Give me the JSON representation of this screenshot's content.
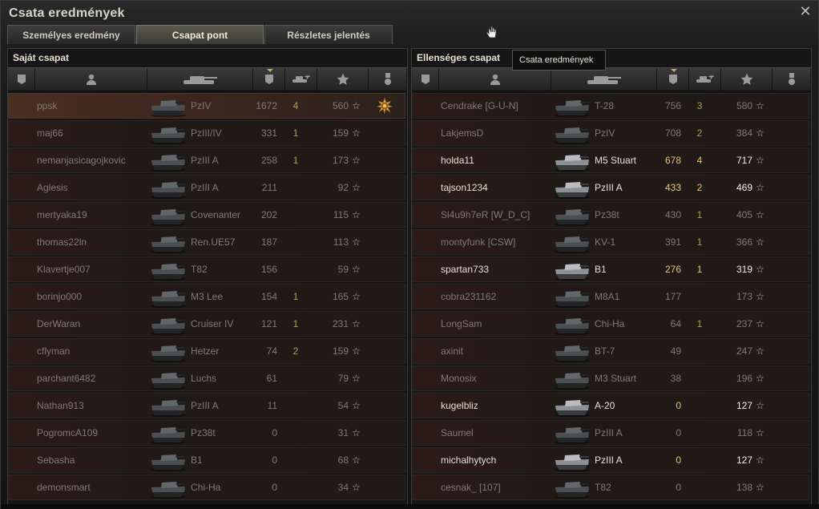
{
  "window": {
    "title": "Csata eredmények"
  },
  "tabs": [
    {
      "label": "Személyes eredmény",
      "active": false
    },
    {
      "label": "Csapat pont",
      "active": true
    },
    {
      "label": "Részletes jelentés",
      "active": false
    }
  ],
  "tooltip": {
    "text": "Csata eredmények"
  },
  "columns": [
    "platoon-icon",
    "player-icon",
    "tank-icon",
    "damage-icon",
    "kills-icon",
    "xp-star-icon",
    "medal-icon"
  ],
  "own_team": {
    "title": "Saját csapat",
    "rows": [
      {
        "name": "ppsk",
        "tank": "PzIV",
        "damage": "1672",
        "kills": "4",
        "xp": "560",
        "medal": true,
        "player": true,
        "alive": false
      },
      {
        "name": "maj66",
        "tank": "PzIII/IV",
        "damage": "331",
        "kills": "1",
        "xp": "159",
        "alive": false
      },
      {
        "name": "nemanjasicagojkovic",
        "tank": "PzIII A",
        "damage": "258",
        "kills": "1",
        "xp": "173",
        "alive": false
      },
      {
        "name": "Aglesis",
        "tank": "PzIII A",
        "damage": "211",
        "kills": "",
        "xp": "92",
        "alive": false
      },
      {
        "name": "mertyaka19",
        "tank": "Covenanter",
        "damage": "202",
        "kills": "",
        "xp": "115",
        "alive": false
      },
      {
        "name": "thomas22ln",
        "tank": "Ren.UE57",
        "damage": "187",
        "kills": "",
        "xp": "113",
        "alive": false
      },
      {
        "name": "Klavertje007",
        "tank": "T82",
        "damage": "156",
        "kills": "",
        "xp": "59",
        "alive": false
      },
      {
        "name": "borinjo000",
        "tank": "M3 Lee",
        "damage": "154",
        "kills": "1",
        "xp": "165",
        "alive": false
      },
      {
        "name": "DerWaran",
        "tank": "Cruiser IV",
        "damage": "121",
        "kills": "1",
        "xp": "231",
        "alive": false
      },
      {
        "name": "cflyman",
        "tank": "Hetzer",
        "damage": "74",
        "kills": "2",
        "xp": "159",
        "alive": false
      },
      {
        "name": "parchant6482",
        "tank": "Luchs",
        "damage": "61",
        "kills": "",
        "xp": "79",
        "alive": false
      },
      {
        "name": "Nathan913",
        "tank": "PzIII A",
        "damage": "11",
        "kills": "",
        "xp": "54",
        "alive": false
      },
      {
        "name": "PogromcA109",
        "tank": "Pz38t",
        "damage": "0",
        "kills": "",
        "xp": "31",
        "alive": false
      },
      {
        "name": "Sebasha",
        "tank": "B1",
        "damage": "0",
        "kills": "",
        "xp": "68",
        "alive": false
      },
      {
        "name": "demonsmart",
        "tank": "Chi-Ha",
        "damage": "0",
        "kills": "",
        "xp": "34",
        "alive": false
      }
    ]
  },
  "enemy_team": {
    "title": "Ellenséges csapat",
    "rows": [
      {
        "name": "Cendrake [G-U-N]",
        "tank": "T-28",
        "damage": "756",
        "kills": "3",
        "xp": "580",
        "alive": false
      },
      {
        "name": "LakjemsD",
        "tank": "PzIV",
        "damage": "708",
        "kills": "2",
        "xp": "384",
        "alive": false
      },
      {
        "name": "holda11",
        "tank": "M5 Stuart",
        "damage": "678",
        "kills": "4",
        "xp": "717",
        "alive": true
      },
      {
        "name": "tajson1234",
        "tank": "PzIII A",
        "damage": "433",
        "kills": "2",
        "xp": "469",
        "alive": true
      },
      {
        "name": "Sl4u9h7eR [W_D_C]",
        "tank": "Pz38t",
        "damage": "430",
        "kills": "1",
        "xp": "405",
        "alive": false
      },
      {
        "name": "montyfunk [CSW]",
        "tank": "KV-1",
        "damage": "391",
        "kills": "1",
        "xp": "366",
        "alive": false
      },
      {
        "name": "spartan733",
        "tank": "B1",
        "damage": "276",
        "kills": "1",
        "xp": "319",
        "alive": true
      },
      {
        "name": "cobra231162",
        "tank": "M8A1",
        "damage": "177",
        "kills": "",
        "xp": "173",
        "alive": false
      },
      {
        "name": "LongSam",
        "tank": "Chi-Ha",
        "damage": "64",
        "kills": "1",
        "xp": "237",
        "alive": false
      },
      {
        "name": "axinit",
        "tank": "BT-7",
        "damage": "49",
        "kills": "",
        "xp": "247",
        "alive": false
      },
      {
        "name": "Monosix",
        "tank": "M3 Stuart",
        "damage": "38",
        "kills": "",
        "xp": "196",
        "alive": false
      },
      {
        "name": "kugelbliz",
        "tank": "A-20",
        "damage": "0",
        "kills": "",
        "xp": "127",
        "alive": true
      },
      {
        "name": "Saumel",
        "tank": "PzIII A",
        "damage": "0",
        "kills": "",
        "xp": "118",
        "alive": false
      },
      {
        "name": "michalhytych",
        "tank": "PzIII A",
        "damage": "0",
        "kills": "",
        "xp": "127",
        "alive": true
      },
      {
        "name": "cesnak_ [107]",
        "tank": "T82",
        "damage": "0",
        "kills": "",
        "xp": "138",
        "alive": false
      }
    ]
  }
}
